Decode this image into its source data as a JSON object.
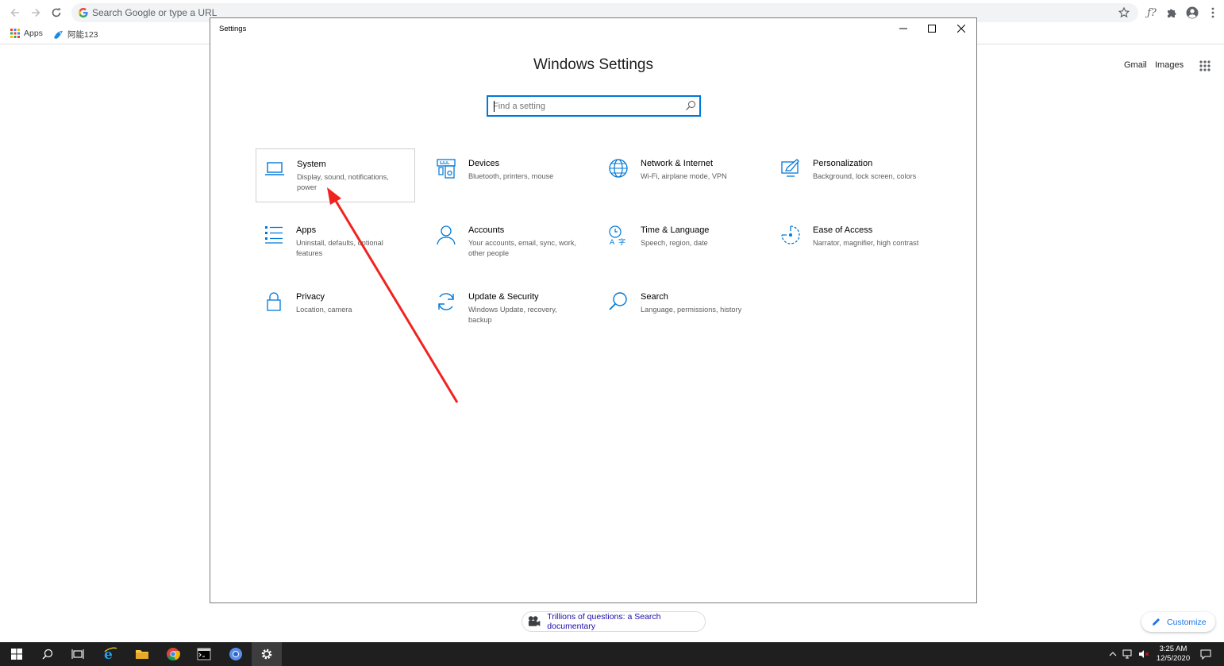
{
  "browser": {
    "omnibox_placeholder": "Search Google or type a URL",
    "bookmarks": [
      {
        "label": "Apps"
      },
      {
        "label": "阿能123"
      }
    ]
  },
  "google_page": {
    "gmail_label": "Gmail",
    "images_label": "Images",
    "doodle_link": "Trillions of questions: a Search documentary",
    "customize_label": "Customize"
  },
  "settings_window": {
    "title": "Settings",
    "heading": "Windows Settings",
    "search_placeholder": "Find a setting",
    "tiles": [
      {
        "title": "System",
        "desc": "Display, sound, notifications, power",
        "icon": "laptop-icon"
      },
      {
        "title": "Devices",
        "desc": "Bluetooth, printers, mouse",
        "icon": "devices-icon"
      },
      {
        "title": "Network & Internet",
        "desc": "Wi-Fi, airplane mode, VPN",
        "icon": "globe-icon"
      },
      {
        "title": "Personalization",
        "desc": "Background, lock screen, colors",
        "icon": "paint-icon"
      },
      {
        "title": "Apps",
        "desc": "Uninstall, defaults, optional features",
        "icon": "apps-list-icon"
      },
      {
        "title": "Accounts",
        "desc": "Your accounts, email, sync, work, other people",
        "icon": "person-icon"
      },
      {
        "title": "Time & Language",
        "desc": "Speech, region, date",
        "icon": "time-language-icon"
      },
      {
        "title": "Ease of Access",
        "desc": "Narrator, magnifier, high contrast",
        "icon": "ease-of-access-icon"
      },
      {
        "title": "Privacy",
        "desc": "Location, camera",
        "icon": "lock-icon"
      },
      {
        "title": "Update & Security",
        "desc": "Windows Update, recovery, backup",
        "icon": "sync-icon"
      },
      {
        "title": "Search",
        "desc": "Language, permissions, history",
        "icon": "search-icon"
      }
    ]
  },
  "taskbar": {
    "time": "3:25 AM",
    "date": "12/5/2020"
  },
  "colors": {
    "accent": "#0078d7",
    "taskbar": "#1f1f1f",
    "annotation_arrow": "#f0231e"
  }
}
